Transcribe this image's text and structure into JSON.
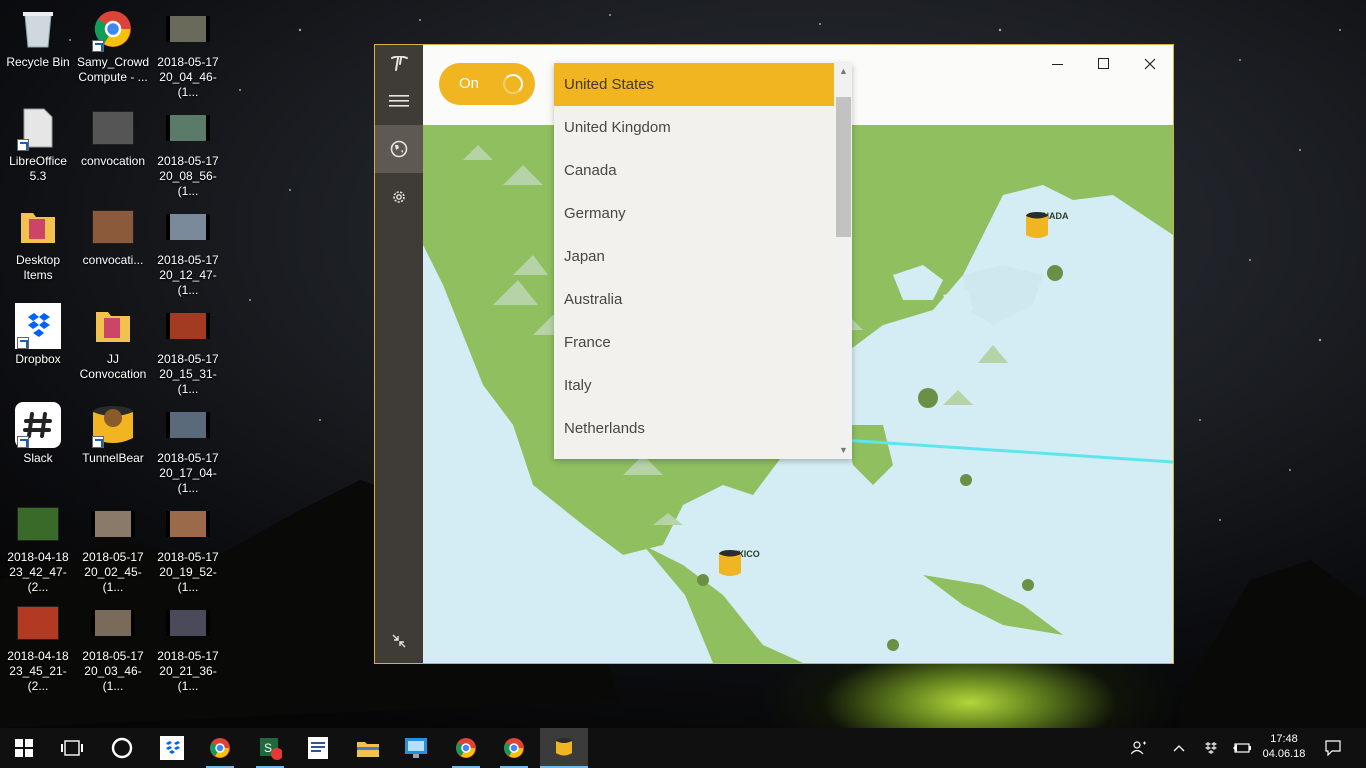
{
  "desktop": {
    "icons": [
      {
        "label": "Recycle Bin"
      },
      {
        "label": "Samy_Crowd Compute - ..."
      },
      {
        "label": "2018-05-17 20_04_46-(1..."
      },
      {
        "label": "LibreOffice 5.3"
      },
      {
        "label": "convocation"
      },
      {
        "label": "2018-05-17 20_08_56-(1..."
      },
      {
        "label": "Desktop Items"
      },
      {
        "label": "convocati..."
      },
      {
        "label": "2018-05-17 20_12_47-(1..."
      },
      {
        "label": "Dropbox"
      },
      {
        "label": "JJ Convocation"
      },
      {
        "label": "2018-05-17 20_15_31-(1..."
      },
      {
        "label": "Slack"
      },
      {
        "label": "TunnelBear"
      },
      {
        "label": "2018-05-17 20_17_04-(1..."
      },
      {
        "label": "2018-04-18 23_42_47-(2..."
      },
      {
        "label": "2018-05-17 20_02_45-(1..."
      },
      {
        "label": "2018-05-17 20_19_52-(1..."
      },
      {
        "label": "2018-04-18 23_45_21-(2..."
      },
      {
        "label": "2018-05-17 20_03_46-(1..."
      },
      {
        "label": "2018-05-17 20_21_36-(1..."
      }
    ]
  },
  "app": {
    "toggle_label": "On",
    "toggle_state": "on",
    "countries": [
      "United States",
      "United Kingdom",
      "Canada",
      "Germany",
      "Japan",
      "Australia",
      "France",
      "Italy",
      "Netherlands"
    ],
    "selected_country": "United States",
    "map_labels": {
      "canada": "CANADA",
      "mexico": "MEXICO"
    },
    "colors": {
      "accent": "#f0b521",
      "sidebar": "#3f3c37",
      "land": "#8fbf5f",
      "water": "#d4ecf3",
      "tunnel": "#5ee6ef"
    }
  },
  "taskbar": {
    "apps": [
      "start",
      "task-view",
      "cortana",
      "dropbox",
      "chrome",
      "skype",
      "word",
      "file-explorer",
      "control-panel",
      "chrome-canary",
      "chrome",
      "tunnelbear"
    ],
    "badge": "35",
    "time": "17:48",
    "date": "04.06.18"
  },
  "icons": {
    "logo": "tunnelbear-logo-icon",
    "menu": "hamburger-icon",
    "globe": "globe-icon",
    "settings": "gear-icon",
    "collapse": "collapse-icon"
  }
}
